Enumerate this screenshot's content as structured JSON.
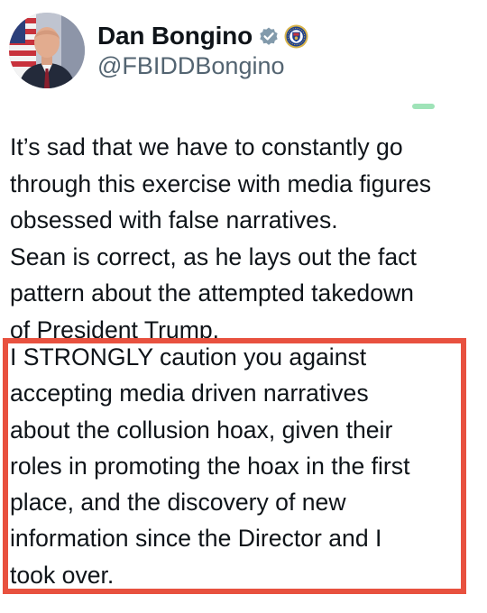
{
  "author": {
    "display_name": "Dan Bongino",
    "handle": "@FBIDDBongino",
    "verified_badge_color": "#829aab",
    "affiliation_badge": "fbi-seal-icon"
  },
  "tweet": {
    "lines": [
      "It’s sad that we have to constantly go",
      "through this exercise with media figures",
      "obsessed with false narratives.",
      "Sean is correct, as he lays out the fact",
      "pattern about the attempted takedown",
      "of President Trump."
    ],
    "highlighted_lines": [
      "I STRONGLY caution you against",
      "accepting media driven narratives",
      "about the collusion hoax, given their",
      "roles in promoting the hoax in the first",
      "place, and the discovery of new",
      "information since the Director and I",
      "took over."
    ],
    "highlight_color": "#e8513f"
  }
}
